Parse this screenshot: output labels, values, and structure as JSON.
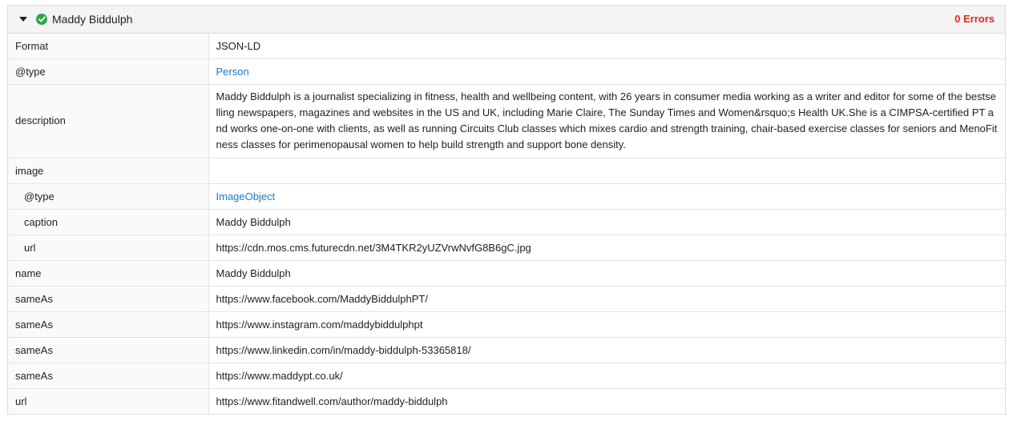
{
  "header": {
    "title": "Maddy Biddulph",
    "errors": "0 Errors",
    "icons": {
      "toggle": "caret-down-icon",
      "status": "check-circle-icon"
    },
    "colors": {
      "status_ok": "#2ba84a",
      "errors": "#e0262a",
      "link": "#1a7ac7"
    }
  },
  "rows": [
    {
      "key": "Format",
      "value": "JSON-LD"
    },
    {
      "key": "@type",
      "value": "Person"
    },
    {
      "key": "description",
      "value": "Maddy Biddulph is a journalist specializing in fitness, health and wellbeing content, with 26 years in consumer media working as a writer and editor for some of the bestselling newspapers, magazines and websites in the US and UK, including Marie Claire, The Sunday Times and Women&rsquo;s Health UK.She is a CIMPSA-certified PT and works one-on-one with clients, as well as running Circuits Club classes which mixes cardio and strength training, chair-based exercise classes for seniors and MenoFitness classes for perimenopausal women to help build strength and support bone density."
    },
    {
      "key": "image",
      "value": ""
    },
    {
      "key": "@type",
      "value": "ImageObject"
    },
    {
      "key": "caption",
      "value": "Maddy Biddulph"
    },
    {
      "key": "url",
      "value": "https://cdn.mos.cms.futurecdn.net/3M4TKR2yUZVrwNvfG8B6gC.jpg"
    },
    {
      "key": "name",
      "value": "Maddy Biddulph"
    },
    {
      "key": "sameAs",
      "value": "https://www.facebook.com/MaddyBiddulphPT/"
    },
    {
      "key": "sameAs",
      "value": "https://www.instagram.com/maddybiddulphpt"
    },
    {
      "key": "sameAs",
      "value": "https://www.linkedin.com/in/maddy-biddulph-53365818/"
    },
    {
      "key": "sameAs",
      "value": "https://www.maddypt.co.uk/"
    },
    {
      "key": "url",
      "value": "https://www.fitandwell.com/author/maddy-biddulph"
    }
  ]
}
